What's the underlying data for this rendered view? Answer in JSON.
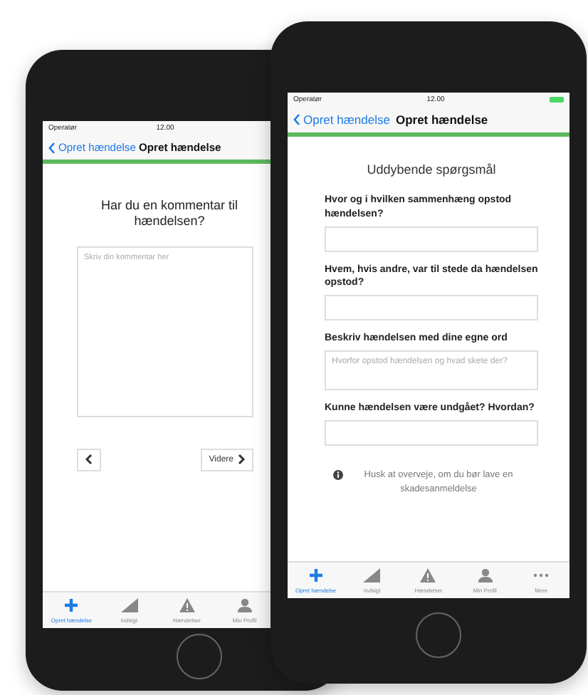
{
  "phones": [
    {
      "kind": "comment",
      "status": {
        "carrier": "Operatør",
        "time": "12.00"
      },
      "nav": {
        "back": "Opret hændelse",
        "title": "Opret hændelse"
      },
      "question": "Har du en kommentar til hændelsen?",
      "comment_field": {
        "placeholder": "Skriv din kommentar her"
      },
      "next_button": "Videre",
      "tabs": [
        {
          "label": "Opret hændelse",
          "kind": "plus",
          "selected": true
        },
        {
          "label": "Indsigt",
          "kind": "chart",
          "selected": false
        },
        {
          "label": "Hændelser",
          "kind": "warning",
          "selected": false
        },
        {
          "label": "Min Profil",
          "kind": "person",
          "selected": false
        }
      ]
    },
    {
      "kind": "form",
      "status": {
        "carrier": "Operatør",
        "time": "12.00"
      },
      "nav": {
        "back": "Opret hændelse",
        "title": "Opret hændelse"
      },
      "heading": "Uddybende spørgsmål",
      "questions": [
        {
          "label": "Hvor og i hvilken sammenhæng opstod hændelsen?"
        },
        {
          "label": "Hvem, hvis andre, var til stede da hændelsen opstod?"
        },
        {
          "label": "Beskriv hændelsen med dine egne ord",
          "placeholder": "Hvorfor opstod hændelsen og hvad skete der?"
        },
        {
          "label": "Kunne hændelsen være undgået? Hvordan?"
        }
      ],
      "note": "Husk at overveje, om du bør lave en skadesanmeldelse",
      "tabs": [
        {
          "label": "Opret hændelse",
          "kind": "plus",
          "selected": true
        },
        {
          "label": "Indsigt",
          "kind": "chart",
          "selected": false
        },
        {
          "label": "Hændelser",
          "kind": "warning",
          "selected": false
        },
        {
          "label": "Min Profil",
          "kind": "person",
          "selected": false
        },
        {
          "label": "Mere",
          "kind": "dots",
          "selected": false
        }
      ]
    }
  ]
}
